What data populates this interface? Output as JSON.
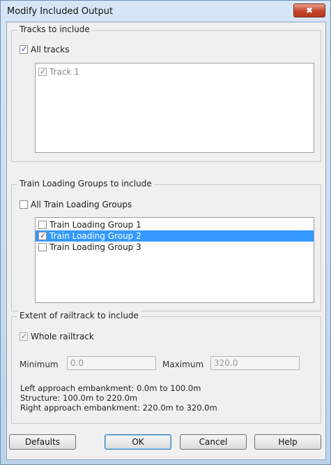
{
  "window": {
    "title": "Modify Included Output",
    "close_glyph": "✖"
  },
  "tracks_group": {
    "title": "Tracks to include",
    "all_label": "All tracks",
    "all_checked": true,
    "items": [
      {
        "label": "Track 1",
        "checked": true
      }
    ]
  },
  "tlg_group": {
    "title": "Train Loading Groups to include",
    "all_label": "All Train Loading Groups",
    "all_checked": false,
    "items": [
      {
        "label": "Train Loading Group 1",
        "checked": false,
        "selected": false
      },
      {
        "label": "Train Loading Group 2",
        "checked": true,
        "selected": true
      },
      {
        "label": "Train Loading Group 3",
        "checked": false,
        "selected": false
      }
    ]
  },
  "extent_group": {
    "title": "Extent of railtrack to include",
    "whole_label": "Whole railtrack",
    "whole_checked": true,
    "min_label": "Minimum",
    "min_value": "0.0",
    "max_label": "Maximum",
    "max_value": "320.0",
    "info": {
      "left": "Left approach embankment: 0.0m to 100.0m",
      "structure": "Structure: 100.0m to 220.0m",
      "right": "Right approach embankment: 220.0m to 320.0m"
    }
  },
  "buttons": {
    "defaults": "Defaults",
    "ok": "OK",
    "cancel": "Cancel",
    "help": "Help"
  },
  "colors": {
    "selection": "#3399ff",
    "title_gradient_top": "#d7e6f6",
    "close_red": "#c4452c"
  }
}
